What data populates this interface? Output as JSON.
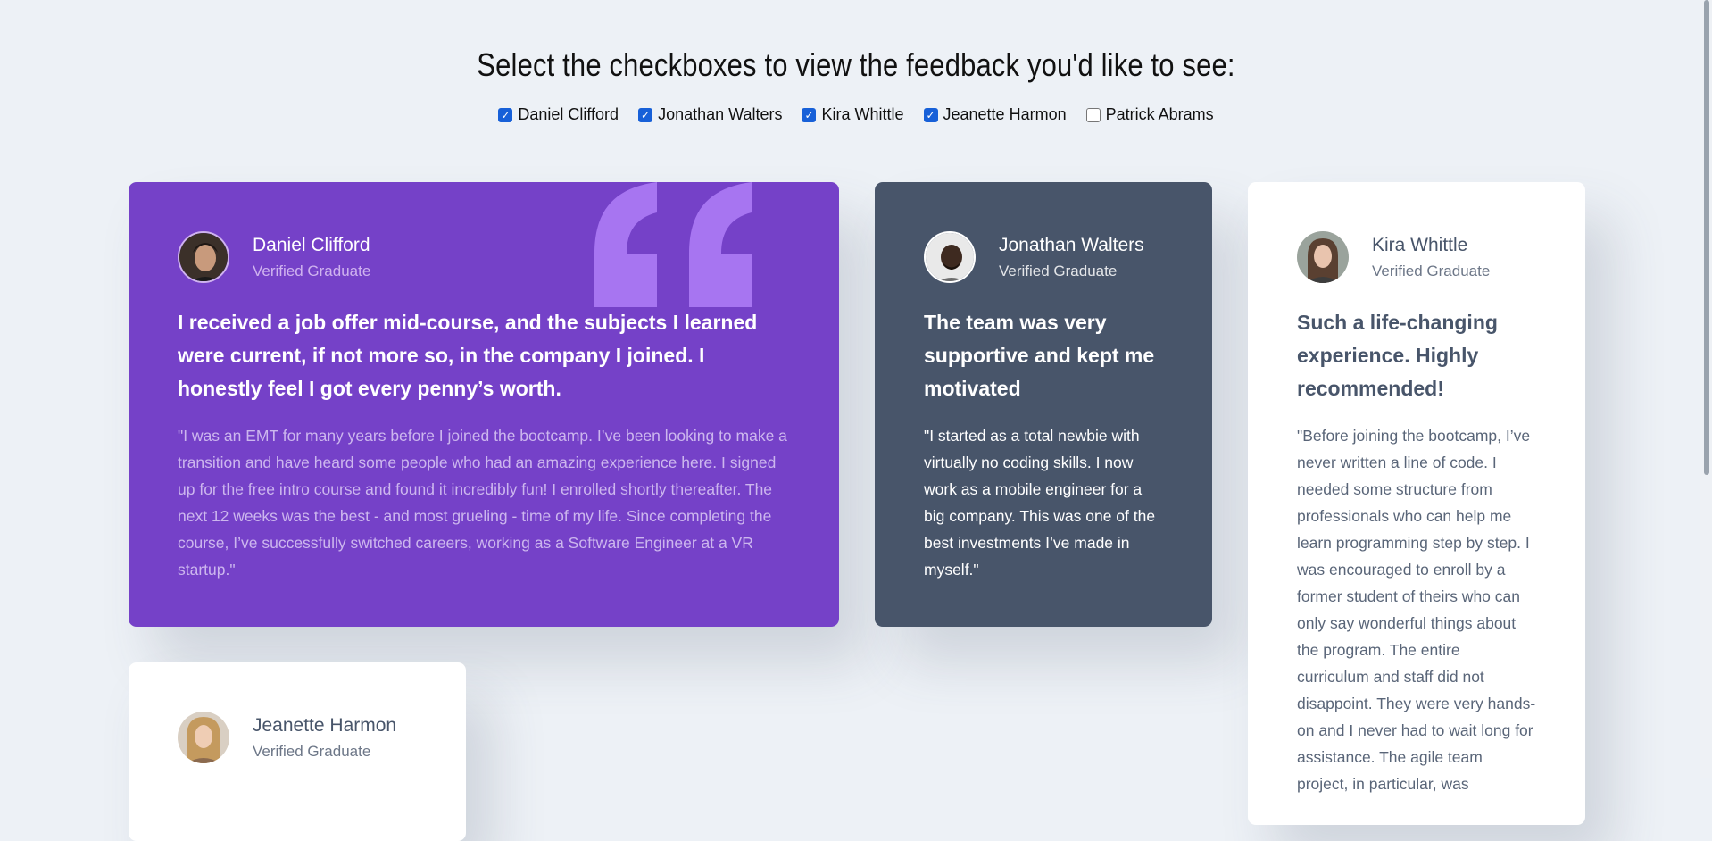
{
  "heading": "Select the checkboxes to view the feedback you'd like to see:",
  "filters": [
    {
      "label": "Daniel Clifford",
      "checked": true
    },
    {
      "label": "Jonathan Walters",
      "checked": true
    },
    {
      "label": "Kira Whittle",
      "checked": true
    },
    {
      "label": "Jeanette Harmon",
      "checked": true
    },
    {
      "label": "Patrick Abrams",
      "checked": false
    }
  ],
  "checkmark": "✓",
  "colors": {
    "background": "#edf1f6",
    "purple": "#7541c8",
    "slate": "#48556a",
    "white": "#ffffff",
    "checkbox_blue": "#1760d8"
  },
  "cards": [
    {
      "name": "Daniel Clifford",
      "role": "Verified Graduate",
      "title": "I received a job offer mid-course, and the subjects I learned were current, if not more so, in the company I joined. I honestly feel I got every penny’s worth.",
      "body": "\"I was an EMT for many years before I joined the bootcamp. I’ve been looking to make a transition and have heard some people who had an amazing experience here. I signed up for the free intro course and found it incredibly fun! I enrolled shortly thereafter. The next 12 weeks was the best - and most grueling - time of my life. Since completing the course, I’ve successfully switched careers, working as a Software Engineer at a VR startup.\""
    },
    {
      "name": "Jonathan Walters",
      "role": "Verified Graduate",
      "title": "The team was very supportive and kept me motivated",
      "body": "\"I started as a total newbie with virtually no coding skills. I now work as a mobile engineer for a big company. This was one of the best investments I’ve made in myself.\""
    },
    {
      "name": "Kira Whittle",
      "role": "Verified Graduate",
      "title": "Such a life-changing experience. Highly recommended!",
      "body": "\"Before joining the bootcamp, I’ve never written a line of code. I needed some structure from professionals who can help me learn programming step by step. I was encouraged to enroll by a former student of theirs who can only say wonderful things about the program. The entire curriculum and staff did not disappoint. They were very hands-on and I never had to wait long for assistance. The agile team project, in particular, was"
    },
    {
      "name": "Jeanette Harmon",
      "role": "Verified Graduate"
    }
  ]
}
